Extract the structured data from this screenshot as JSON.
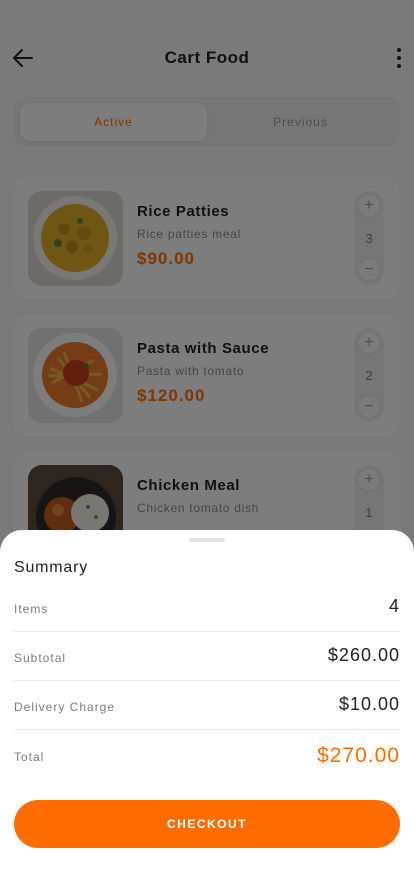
{
  "header": {
    "title": "Cart Food",
    "back_icon": "arrow-left-icon",
    "menu_icon": "more-vertical-icon"
  },
  "tabs": [
    {
      "label": "Active",
      "selected": true
    },
    {
      "label": "Previous",
      "selected": false
    }
  ],
  "cart": {
    "items": [
      {
        "name": "Rice Patties",
        "description": "Rice patties meal",
        "price": "$90.00",
        "quantity": "3"
      },
      {
        "name": "Pasta with Sauce",
        "description": "Pasta with tomato",
        "price": "$120.00",
        "quantity": "2"
      },
      {
        "name": "Chicken Meal",
        "description": "Chicken tomato dish",
        "price": "",
        "quantity": "1"
      }
    ]
  },
  "summary": {
    "title": "Summary",
    "items_label": "Items",
    "items_value": "4",
    "subtotal_label": "Subtotal",
    "subtotal_value": "$260.00",
    "delivery_label": "Delivery Charge",
    "delivery_value": "$10.00",
    "total_label": "Total",
    "total_value": "$270.00",
    "checkout_label": "CHECKOUT"
  },
  "colors": {
    "accent": "#ff6d00",
    "overlay": "rgba(0,0,0,0.5)"
  }
}
